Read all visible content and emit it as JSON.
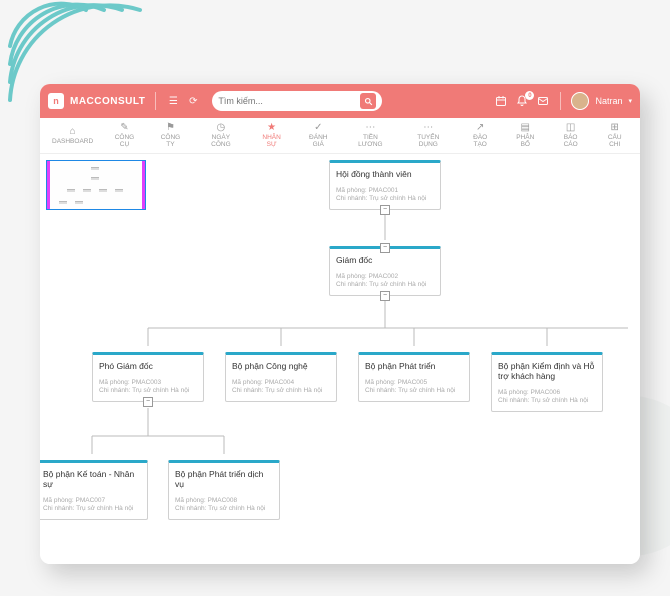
{
  "app": {
    "name": "MACCONSULT"
  },
  "search": {
    "placeholder": "Tìm kiếm..."
  },
  "user": {
    "name": "Natran",
    "notif_count": "0"
  },
  "nav": [
    {
      "label": "DASHBOARD"
    },
    {
      "label": "CÔNG CỤ"
    },
    {
      "label": "CÔNG TY"
    },
    {
      "label": "NGÀY CÔNG"
    },
    {
      "label": "NHÂN SỰ"
    },
    {
      "label": "ĐÁNH GIÁ"
    },
    {
      "label": "TIỀN LƯƠNG"
    },
    {
      "label": "TUYỂN DỤNG"
    },
    {
      "label": "ĐÀO TẠO"
    },
    {
      "label": "PHÂN BỔ"
    },
    {
      "label": "BÁO CÁO"
    },
    {
      "label": "CẤU CHI"
    }
  ],
  "nodes": {
    "n1": {
      "title": "Hội đồng thành viên",
      "code": "Mã phòng: PMAC001",
      "branch": "Chi nhánh: Trụ sở chính Hà nội"
    },
    "n2": {
      "title": "Giám đốc",
      "code": "Mã phòng: PMAC002",
      "branch": "Chi nhánh: Trụ sở chính Hà nội"
    },
    "n3": {
      "title": "Phó Giám đốc",
      "code": "Mã phòng: PMAC003",
      "branch": "Chi nhánh: Trụ sở chính Hà nội"
    },
    "n4": {
      "title": "Bộ phận Công nghệ",
      "code": "Mã phòng: PMAC004",
      "branch": "Chi nhánh: Trụ sở chính Hà nội"
    },
    "n5": {
      "title": "Bộ phận Phát triển",
      "code": "Mã phòng: PMAC005",
      "branch": "Chi nhánh: Trụ sở chính Hà nội"
    },
    "n6": {
      "title": "Bộ phận Kiểm định và Hỗ trợ khách hàng",
      "code": "Mã phòng: PMAC006",
      "branch": "Chi nhánh: Trụ sở chính Hà nội"
    },
    "n7": {
      "title": "Bộ phận Kế toán - Nhân sự",
      "code": "Mã phòng: PMAC007",
      "branch": "Chi nhánh: Trụ sở chính Hà nội"
    },
    "n8": {
      "title": "Bộ phận Phát triển dịch vụ",
      "code": "Mã phòng: PMAC008",
      "branch": "Chi nhánh: Trụ sở chính Hà nội"
    }
  }
}
